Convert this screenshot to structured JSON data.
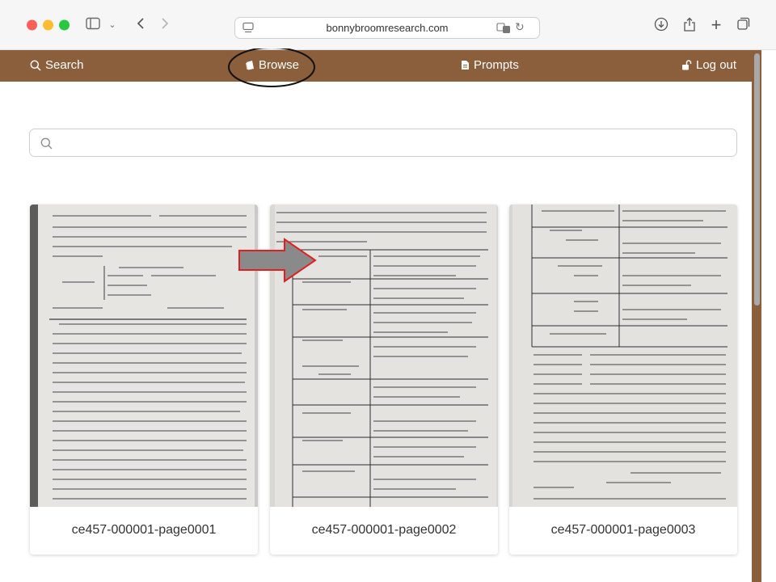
{
  "browser": {
    "url": "bonnybroomresearch.com"
  },
  "nav": {
    "search": "Search",
    "browse": "Browse",
    "prompts": "Prompts",
    "logout": "Log out"
  },
  "search": {
    "placeholder": ""
  },
  "cards": [
    {
      "title": "ce457-000001-page0001"
    },
    {
      "title": "ce457-000001-page0002"
    },
    {
      "title": "ce457-000001-page0003"
    }
  ],
  "colors": {
    "nav_bg": "#8b5e3c",
    "annotation_arrow_fill": "#8a8a8a",
    "annotation_arrow_stroke": "#e02020"
  }
}
